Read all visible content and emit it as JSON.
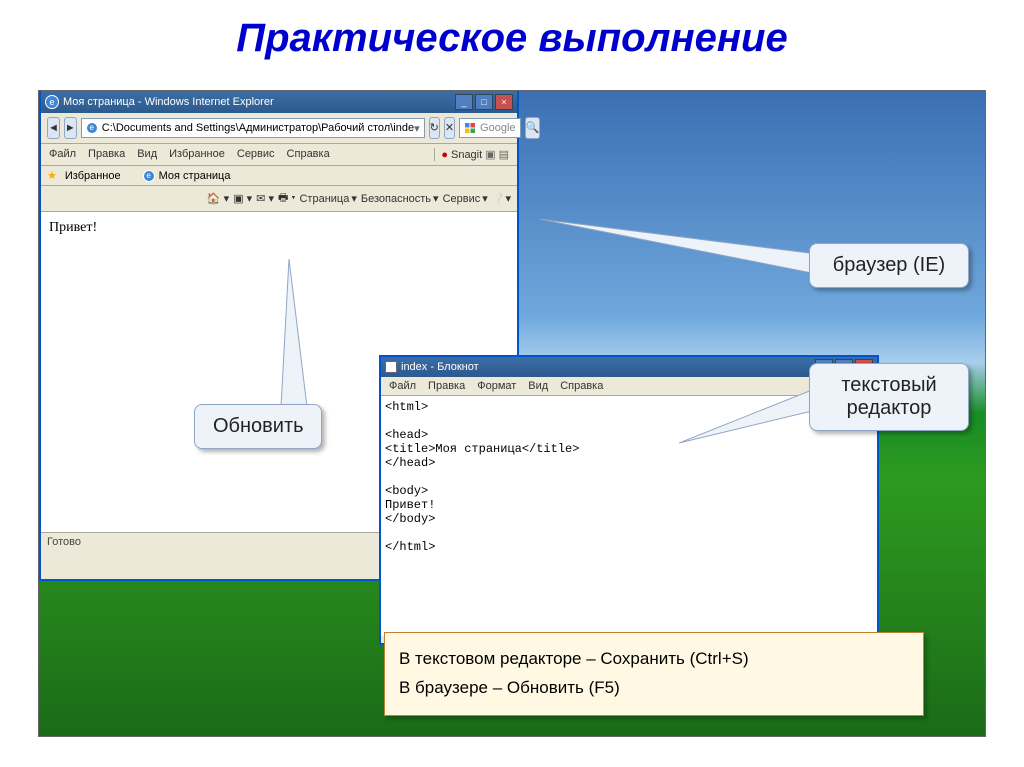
{
  "slide": {
    "title": "Практическое выполнение"
  },
  "ie": {
    "title": "Моя страница - Windows Internet Explorer",
    "address": "C:\\Documents and Settings\\Администратор\\Рабочий стол\\inde",
    "search_placeholder": "Google",
    "menu": [
      "Файл",
      "Правка",
      "Вид",
      "Избранное",
      "Сервис",
      "Справка"
    ],
    "snagit": "Snagit",
    "fav_label": "Избранное",
    "tab_title": "Моя страница",
    "tools": {
      "page": "Страница",
      "security": "Безопасность",
      "service": "Сервис"
    },
    "content": "Привет!",
    "status": "Готово"
  },
  "notepad": {
    "title": "index - Блокнот",
    "menu": [
      "Файл",
      "Правка",
      "Формат",
      "Вид",
      "Справка"
    ],
    "lines": "<html>\n\n<head>\n<title>Моя страница</title>\n</head>\n\n<body>\nПривет!\n</body>\n\n</html>"
  },
  "callouts": {
    "refresh": "Обновить",
    "browser": "браузер (IE)",
    "editor_l1": "текстовый",
    "editor_l2": "редактор"
  },
  "infobox": {
    "line1": "В текстовом редакторе – Сохранить (Ctrl+S)",
    "line2": "В браузере – Обновить (F5)"
  }
}
